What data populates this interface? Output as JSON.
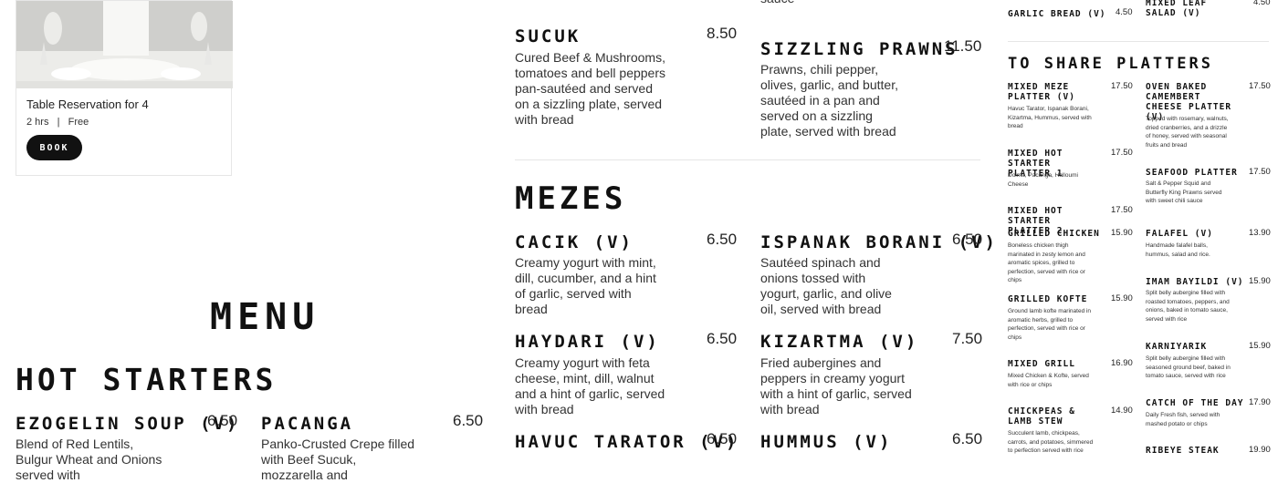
{
  "reservation": {
    "title": "Table Reservation for 4",
    "duration": "2 hrs",
    "separator": "|",
    "price": "Free",
    "book_label": "BOOK"
  },
  "headings": {
    "menu": "MENU",
    "hot_starters": "HOT STARTERS",
    "mezes": "MEZES",
    "share": "TO SHARE PLATTERS"
  },
  "items": {
    "sucuk": {
      "name": "SUCUK",
      "price": "8.50",
      "desc": "Cured Beef & Mushrooms, tomatoes and bell peppers pan-sautéed and served on a sizzling plate, served with bread"
    },
    "sizzling_prawns": {
      "name": "SIZZLING PRAWNS",
      "price": "11.50",
      "desc": "Prawns, chili pepper, olives, garlic, and butter, sautéed in a pan and served on a sizzling plate, served with bread",
      "top_fragment": "sauce"
    },
    "cacik": {
      "name": "CACIK (V)",
      "price": "6.50",
      "desc": "Creamy yogurt with mint, dill, cucumber, and a hint of garlic, served with bread"
    },
    "ispanak": {
      "name": "ISPANAK BORANI (V)",
      "price": "6.50",
      "desc": "Sautéed spinach and onions  tossed with yogurt, garlic, and olive oil, served with bread"
    },
    "haydari": {
      "name": "HAYDARI (V)",
      "price": "6.50",
      "desc": "Creamy yogurt with feta cheese, mint, dill, walnut and a hint of garlic, served with bread"
    },
    "kizartma": {
      "name": "KIZARTMA (V)",
      "price": "7.50",
      "desc": "Fried aubergines and peppers in creamy yogurt with a hint of garlic, served with bread"
    },
    "havuc": {
      "name": "HAVUC TARATOR (V)",
      "price": "6.50"
    },
    "hummus": {
      "name": "HUMMUS (V)",
      "price": "6.50"
    },
    "ezogelin": {
      "name": "EZOGELIN SOUP (V)",
      "price": "6.50",
      "desc": "Blend of Red Lentils, Bulgur Wheat and Onions served with"
    },
    "pacanga": {
      "name": "PACANGA",
      "price": "6.50",
      "desc": "Panko-Crusted Crepe filled with Beef Sucuk, mozzarella and"
    }
  },
  "share_col1": [
    {
      "name": "GARLIC BREAD (V)",
      "price": "4.50",
      "desc": ""
    },
    {
      "name": "MIXED MEZE PLATTER (V)",
      "price": "17.50",
      "desc": "Havuc Tarator, Ispanak Borani, Kizartma, Hummus, served with bread"
    },
    {
      "name": "MIXED HOT STARTER PLATTER 1",
      "price": "17.50",
      "desc": "Dolma, Pacanga, Halloumi Cheese"
    },
    {
      "name": "MIXED HOT STARTER PLATTER 2",
      "price": "17.50",
      "desc": ""
    },
    {
      "name": "GRILLED CHICKEN",
      "price": "15.90",
      "desc": "Boneless chicken thigh marinated in zesty lemon and aromatic spices, grilled to perfection, served with rice or chips"
    },
    {
      "name": "GRILLED KOFTE",
      "price": "15.90",
      "desc": "Ground lamb kofte marinated in aromatic herbs, grilled to perfection, served with rice or chips"
    },
    {
      "name": "MIXED GRILL",
      "price": "16.90",
      "desc": "Mixed Chicken & Kofte, served with rice or chips"
    },
    {
      "name": "CHICKPEAS & LAMB STEW",
      "price": "14.90",
      "desc": "Succulent lamb, chickpeas, carrots, and potatoes, simmered to perfection served with rice"
    }
  ],
  "share_col2": [
    {
      "name": "MIXED LEAF SALAD (V)",
      "price": "4.50",
      "desc": ""
    },
    {
      "name": "OVEN BAKED CAMEMBERT CHEESE PLATTER (V)",
      "price": "17.50",
      "desc": "Topped with rosemary, walnuts, dried cranberries, and a drizzle of honey, served with seasonal fruits and bread"
    },
    {
      "name": "SEAFOOD PLATTER",
      "price": "17.50",
      "desc": "Salt & Pepper Squid and Butterfly King Prawns served with sweet chili sauce"
    },
    {
      "name": "FALAFEL (V)",
      "price": "13.90",
      "desc": "Handmade falafel balls, hummus, salad and rice."
    },
    {
      "name": "IMAM BAYILDI (V)",
      "price": "15.90",
      "desc": "Split belly aubergine filled with roasted tomatoes, peppers, and onions, baked in tomato sauce, served with rice"
    },
    {
      "name": "KARNIYARIK",
      "price": "15.90",
      "desc": "Split belly aubergine filled with seasoned ground beef, baked in tomato sauce, served with rice"
    },
    {
      "name": "CATCH OF THE DAY",
      "price": "17.90",
      "desc": "Daily Fresh fish, served with mashed potato or chips"
    },
    {
      "name": "RIBEYE STEAK",
      "price": "19.90",
      "desc": ""
    }
  ]
}
